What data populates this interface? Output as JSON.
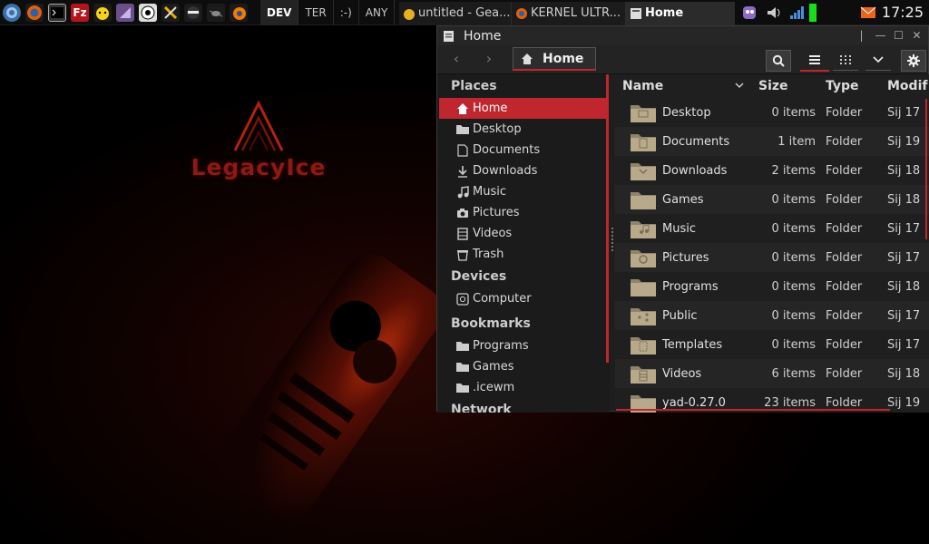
{
  "taskbar": {
    "workspaces": [
      "DEV",
      "TER",
      ":-)",
      "ANY"
    ],
    "tasks": [
      {
        "label": "untitled - Gea...",
        "active": false
      },
      {
        "label": "KERNEL ULTR...",
        "active": false
      },
      {
        "label": "Home",
        "active": true
      }
    ],
    "clock": "17:25"
  },
  "desktop": {
    "logo_text": "LegacyIce"
  },
  "window": {
    "title": "Home",
    "breadcrumb": "Home"
  },
  "sidebar": {
    "places_header": "Places",
    "places": [
      {
        "label": "Home",
        "icon": "home-icon",
        "selected": true
      },
      {
        "label": "Desktop",
        "icon": "folder-icon"
      },
      {
        "label": "Documents",
        "icon": "document-icon"
      },
      {
        "label": "Downloads",
        "icon": "download-icon"
      },
      {
        "label": "Music",
        "icon": "music-icon"
      },
      {
        "label": "Pictures",
        "icon": "camera-icon"
      },
      {
        "label": "Videos",
        "icon": "film-icon"
      },
      {
        "label": "Trash",
        "icon": "trash-icon"
      }
    ],
    "devices_header": "Devices",
    "devices": [
      {
        "label": "Computer",
        "icon": "drive-icon"
      }
    ],
    "bookmarks_header": "Bookmarks",
    "bookmarks": [
      {
        "label": "Programs",
        "icon": "folder-icon"
      },
      {
        "label": "Games",
        "icon": "folder-icon"
      },
      {
        "label": ".icewm",
        "icon": "folder-icon"
      }
    ],
    "network_header": "Network"
  },
  "list": {
    "columns": {
      "name": "Name",
      "size": "Size",
      "type": "Type",
      "modified": "Modif"
    },
    "rows": [
      {
        "name": "Desktop",
        "size": "0 items",
        "type": "Folder",
        "modified": "Sij 17"
      },
      {
        "name": "Documents",
        "size": "1 item",
        "type": "Folder",
        "modified": "Sij 19"
      },
      {
        "name": "Downloads",
        "size": "2 items",
        "type": "Folder",
        "modified": "Sij 18"
      },
      {
        "name": "Games",
        "size": "0 items",
        "type": "Folder",
        "modified": "Sij 18"
      },
      {
        "name": "Music",
        "size": "0 items",
        "type": "Folder",
        "modified": "Sij 17"
      },
      {
        "name": "Pictures",
        "size": "0 items",
        "type": "Folder",
        "modified": "Sij 17"
      },
      {
        "name": "Programs",
        "size": "0 items",
        "type": "Folder",
        "modified": "Sij 18"
      },
      {
        "name": "Public",
        "size": "0 items",
        "type": "Folder",
        "modified": "Sij 17"
      },
      {
        "name": "Templates",
        "size": "0 items",
        "type": "Folder",
        "modified": "Sij 17"
      },
      {
        "name": "Videos",
        "size": "6 items",
        "type": "Folder",
        "modified": "Sij 18"
      },
      {
        "name": "yad-0.27.0",
        "size": "23 items",
        "type": "Folder",
        "modified": "Sij 19"
      }
    ]
  },
  "colors": {
    "accent": "#c0262d",
    "folder": "#b8a98a",
    "background": "#1e1e1e"
  }
}
